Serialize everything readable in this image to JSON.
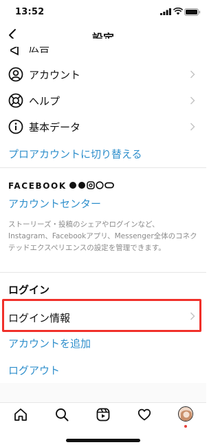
{
  "status_bar": {
    "time": "13:52"
  },
  "header": {
    "title": "設定"
  },
  "rows": {
    "ads": "広告",
    "account": "アカウント",
    "help": "ヘルプ",
    "about": "基本データ"
  },
  "switch_pro": "プロアカウントに切り替える",
  "facebook": {
    "brand": "FACEBOOK",
    "accounts_center": "アカウントセンター",
    "description": "ストーリーズ・投稿のシェアやログインなど、Instagram、Facebookアプリ、Messenger全体のコネクテッドエクスペリエンスの設定を管理できます。"
  },
  "login_section": {
    "heading": "ログイン",
    "login_info": "ログイン情報",
    "add_account": "アカウントを追加",
    "logout": "ログアウト"
  },
  "colors": {
    "link": "#2f8fcc",
    "highlight": "#f0302a"
  },
  "tab_bar": [
    "home-icon",
    "search-icon",
    "reels-icon",
    "heart-icon",
    "profile-avatar"
  ]
}
